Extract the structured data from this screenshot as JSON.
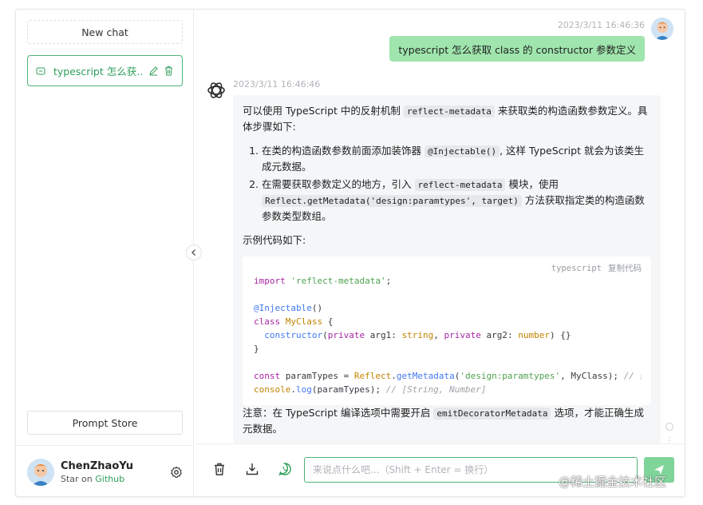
{
  "sidebar": {
    "new_chat_label": "New chat",
    "chat_items": [
      {
        "label": "typescript 怎么获..."
      }
    ],
    "prompt_store_label": "Prompt Store",
    "user": {
      "name": "ChenZhaoYu",
      "star_prefix": "Star on",
      "star_link": "Github"
    }
  },
  "conversation": {
    "user_message": {
      "time": "2023/3/11 16:46:36",
      "text": "typescript 怎么获取 class 的 constructor 参数定义"
    },
    "bot_message": {
      "time": "2023/3/11 16:46:46",
      "intro_a": "可以使用 TypeScript 中的反射机制",
      "intro_code": "reflect-metadata",
      "intro_b": "来获取类的构造函数参数定义。具体步骤如下:",
      "step1_a": "在类的构造函数参数前面添加装饰器",
      "step1_code": "@Injectable()",
      "step1_b": ", 这样 TypeScript 就会为该类生成元数据。",
      "step2_a": "在需要获取参数定义的地方，引入",
      "step2_code": "reflect-metadata",
      "step2_b": "模块，使用",
      "step2_code2": "Reflect.getMetadata('design:paramtypes', target)",
      "step2_c": "方法获取指定类的构造函数参数类型数组。",
      "example_label": "示例代码如下:",
      "code": {
        "language": "typescript",
        "copy_label": "复制代码",
        "l1a": "import",
        "l1b": "'reflect-metadata'",
        "l1c": ";",
        "l3": "@Injectable",
        "l3b": "()",
        "l4a": "class",
        "l4b": "MyClass",
        "l4c": "{",
        "l5a": "constructor",
        "l5b": "(",
        "l5c": "private",
        "l5d": "arg1:",
        "l5e": "string",
        "l5f": ",",
        "l5g": "private",
        "l5h": "arg2:",
        "l5i": "number",
        "l5j": ") {}",
        "l6": "}",
        "l8a": "const",
        "l8b": "paramTypes =",
        "l8c": "Reflect",
        "l8d": ".",
        "l8e": "getMetadata",
        "l8f": "(",
        "l8g": "'design:paramtypes'",
        "l8h": ", MyClass);",
        "l8i": "// 获取 My",
        "l9a": "console",
        "l9b": ".",
        "l9c": "log",
        "l9d": "(paramTypes);",
        "l9e": "// [String, Number]"
      },
      "note_a": "注意：在 TypeScript 编译选项中需要开启",
      "note_code": "emitDecoratorMetadata",
      "note_b": "选项，才能正确生成元数据。"
    }
  },
  "footer": {
    "input_placeholder": "来说点什么吧...（Shift + Enter = 换行）"
  },
  "watermark": "@稀土掘金技术社区",
  "colors": {
    "accent": "#4fb477",
    "user_bubble": "#9fe5ad",
    "send_button": "#7fd49a"
  }
}
